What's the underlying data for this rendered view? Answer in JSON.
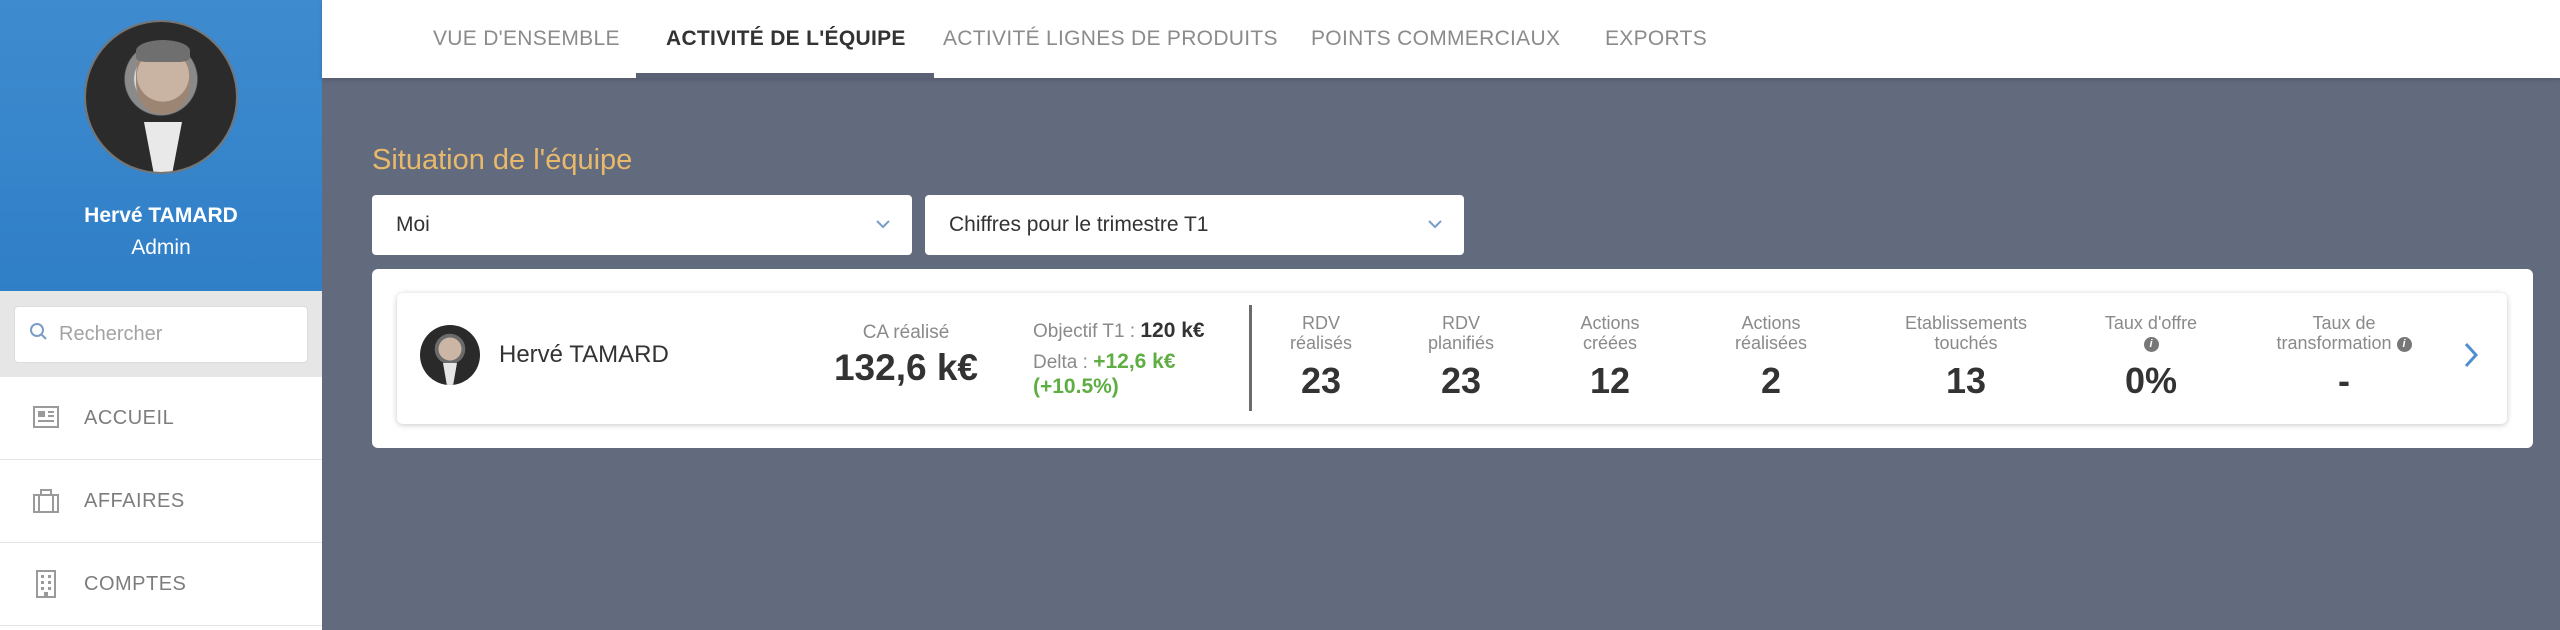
{
  "sidebar": {
    "user": {
      "name": "Hervé TAMARD",
      "role": "Admin"
    },
    "search": {
      "placeholder": "Rechercher"
    },
    "items": [
      {
        "label": "ACCUEIL",
        "icon": "newspaper-icon"
      },
      {
        "label": "AFFAIRES",
        "icon": "briefcase-icon"
      },
      {
        "label": "COMPTES",
        "icon": "building-icon"
      }
    ]
  },
  "tabs": [
    {
      "label": "VUE D'ENSEMBLE",
      "active": false
    },
    {
      "label": "ACTIVITÉ DE L'ÉQUIPE",
      "active": true
    },
    {
      "label": "ACTIVITÉ LIGNES DE PRODUITS",
      "active": false
    },
    {
      "label": "POINTS COMMERCIAUX",
      "active": false
    },
    {
      "label": "EXPORTS",
      "active": false
    }
  ],
  "main": {
    "title": "Situation de l'équipe",
    "filters": {
      "scope": "Moi",
      "period": "Chiffres pour le trimestre T1"
    },
    "card": {
      "name": "Hervé TAMARD",
      "ca_label": "CA réalisé",
      "ca_value": "132,6 k€",
      "objective_label": "Objectif T1 :",
      "objective_value": "120 k€",
      "delta_label": "Delta :",
      "delta_value": "+12,6 k€",
      "delta_percent": "(+10.5%)",
      "stats": [
        {
          "label1": "RDV",
          "label2": "réalisés",
          "value": "23",
          "info": false
        },
        {
          "label1": "RDV",
          "label2": "planifiés",
          "value": "23",
          "info": false
        },
        {
          "label1": "Actions",
          "label2": "créées",
          "value": "12",
          "info": false
        },
        {
          "label1": "Actions",
          "label2": "réalisées",
          "value": "2",
          "info": false
        },
        {
          "label1": "Etablissements",
          "label2": "touchés",
          "value": "13",
          "info": false
        },
        {
          "label1": "Taux d'offre",
          "label2": "",
          "value": "0%",
          "info": true
        },
        {
          "label1": "Taux de",
          "label2": "transformation",
          "value": "-",
          "info": true
        }
      ]
    }
  },
  "colors": {
    "sidebar_header": "#3f8bcf",
    "background": "#626a7e",
    "title_accent": "#e8b96a",
    "delta_green": "#5fae44"
  }
}
